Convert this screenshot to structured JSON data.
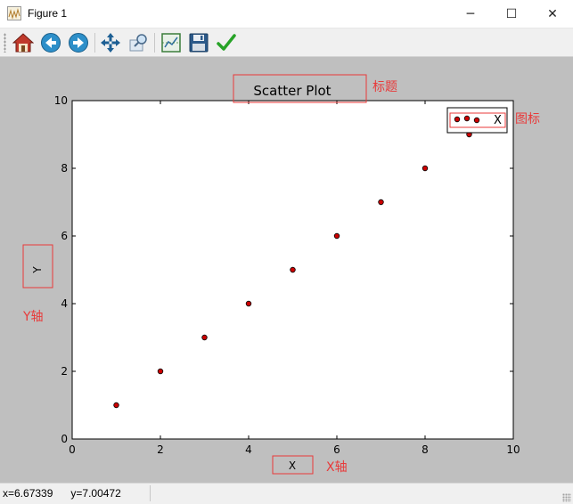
{
  "window": {
    "title": "Figure 1",
    "minimize_glyph": "─",
    "maximize_glyph": "☐",
    "close_glyph": "✕"
  },
  "toolbar": {
    "buttons": [
      {
        "name": "home-button",
        "icon": "home-icon"
      },
      {
        "name": "back-button",
        "icon": "back-arrow-icon"
      },
      {
        "name": "forward-button",
        "icon": "forward-arrow-icon"
      },
      {
        "name": "pan-button",
        "icon": "move-arrows-icon"
      },
      {
        "name": "zoom-button",
        "icon": "zoom-rect-icon"
      },
      {
        "name": "configure-subplots-button",
        "icon": "subplots-icon"
      },
      {
        "name": "save-button",
        "icon": "floppy-disk-icon"
      },
      {
        "name": "edit-parameters-button",
        "icon": "checkmark-icon"
      }
    ]
  },
  "chart_data": {
    "type": "scatter",
    "title": "Scatter Plot",
    "xlabel": "X",
    "ylabel": "Y",
    "xlim": [
      0,
      10
    ],
    "ylim": [
      0,
      10
    ],
    "xticks": [
      "0",
      "2",
      "4",
      "6",
      "8",
      "10"
    ],
    "yticks": [
      "0",
      "2",
      "4",
      "6",
      "8",
      "10"
    ],
    "grid": false,
    "legend_placement": "top-right",
    "series": [
      {
        "name": "X",
        "color": "#cc0000",
        "points": [
          {
            "x": 1,
            "y": 1
          },
          {
            "x": 2,
            "y": 2
          },
          {
            "x": 3,
            "y": 3
          },
          {
            "x": 4,
            "y": 4
          },
          {
            "x": 5,
            "y": 5
          },
          {
            "x": 6,
            "y": 6
          },
          {
            "x": 7,
            "y": 7
          },
          {
            "x": 8,
            "y": 8
          },
          {
            "x": 9,
            "y": 9
          }
        ]
      }
    ],
    "annotations": {
      "title_label": "标题",
      "legend_label": "图标",
      "yaxis_label": "Y轴",
      "xaxis_label": "X轴",
      "color": "#e83a3a"
    }
  },
  "status": {
    "text": "x=6.67339      y=7.00472"
  }
}
